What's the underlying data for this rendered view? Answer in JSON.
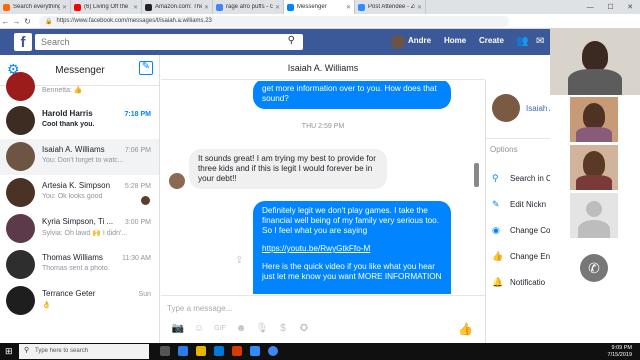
{
  "browser": {
    "tabs": [
      {
        "title": "Search everything on Sound",
        "color": "#ff6a00",
        "active": false
      },
      {
        "title": "(6) Living Off the Top of the",
        "color": "#ff0000",
        "active": false
      },
      {
        "title": "Amazon.com: The Lion In Yo",
        "color": "#222222",
        "active": false
      },
      {
        "title": "rage afro puffs - Google Se",
        "color": "#4285f4",
        "active": false
      },
      {
        "title": "Messenger",
        "color": "#0084ff",
        "active": true
      },
      {
        "title": "Post Attendee - Zoom",
        "color": "#2d8cff",
        "active": false
      }
    ],
    "url": "https://www.facebook.com/messages/t/isaiah.a.williams.23"
  },
  "facebook": {
    "logo": "f",
    "search_placeholder": "Search",
    "user_name": "Andre",
    "home_label": "Home",
    "create_label": "Create"
  },
  "messenger": {
    "title": "Messenger",
    "conversations": [
      {
        "name": "",
        "snippet": "Bennetta: 👍",
        "time": "",
        "avatar": "#9c1c1c",
        "unread": false,
        "selected": false
      },
      {
        "name": "Harold Harris",
        "snippet": "Cool thank you.",
        "time": "7:18 PM",
        "avatar": "#3d2c22",
        "unread": true,
        "selected": false
      },
      {
        "name": "Isaiah A. Williams",
        "snippet": "You: Don't forget to watc...",
        "time": "7:06 PM",
        "avatar": "#6e5443",
        "unread": false,
        "selected": true
      },
      {
        "name": "Artesia K. Simpson",
        "snippet": "You: Ok looks good",
        "time": "5:28 PM",
        "avatar": "#4a3326",
        "unread": false,
        "selected": false
      },
      {
        "name": "Kyria Simpson, Ti ...",
        "snippet": "Sylvia: Oh lawd 🙌 I didn'...",
        "time": "3:00 PM",
        "avatar": "#5c3a4a",
        "unread": false,
        "selected": false
      },
      {
        "name": "Thomas Williams",
        "snippet": "Thomas sent a photo.",
        "time": "11:30 AM",
        "avatar": "#2e2e2e",
        "unread": false,
        "selected": false
      },
      {
        "name": "Terrance Geter",
        "snippet": "👌",
        "time": "Sun",
        "avatar": "#1e1e1e",
        "unread": false,
        "selected": false
      }
    ]
  },
  "thread": {
    "contact_name": "Isaiah A. Williams",
    "msg_top": "get more information over to you.  How does that sound?",
    "timestamp": "THU 2:59 PM",
    "msg_in": "It sounds great! I am trying my best to provide for three kids and if this is legit I would forever be in your debt!!",
    "msg_out_1": "Definitely legit we don't play games.  I take the financial well being of my family very serious too.  So I feel what you are saying",
    "msg_out_link": "https://youtu.be/RwyGtkFfo-M",
    "msg_out_2": "Here is the quick video if you like what you hear just let me know you want MORE INFORMATION",
    "compose_placeholder": "Type a message..."
  },
  "details": {
    "name": "Isaiah A",
    "options_label": "Options",
    "items": [
      {
        "label": "Search in C",
        "icon": "search-icon"
      },
      {
        "label": "Edit Nickn",
        "icon": "pencil-icon"
      },
      {
        "label": "Change Co",
        "icon": "palette-icon"
      },
      {
        "label": "Change En",
        "icon": "like-icon"
      },
      {
        "label": "Notificatio",
        "icon": "bell-icon"
      }
    ]
  },
  "taskbar": {
    "search_placeholder": "Type here to search",
    "time": "9:09 PM",
    "date": "7/15/2019"
  }
}
